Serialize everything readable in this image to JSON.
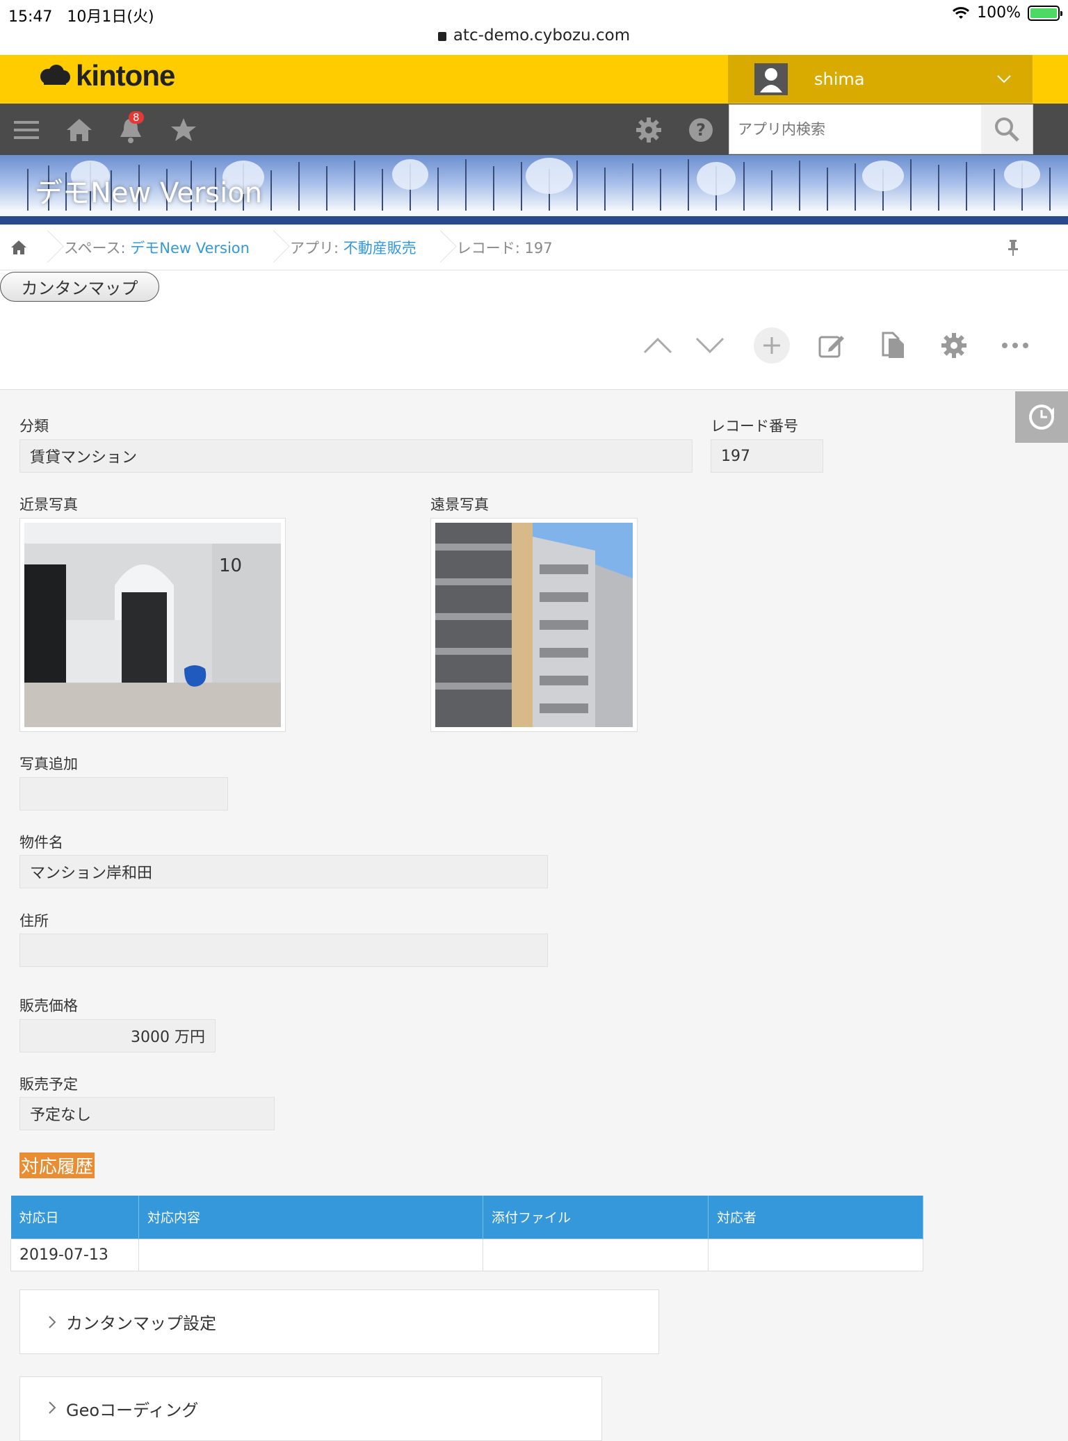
{
  "status_bar": {
    "time": "15:47",
    "date": "10月1日(火)",
    "battery": "100%"
  },
  "browser": {
    "url": "atc-demo.cybozu.com"
  },
  "header": {
    "logo": "kintone",
    "user": "shima",
    "notification_count": "8",
    "search_placeholder": "アプリ内検索"
  },
  "banner": {
    "title": "デモNew Version"
  },
  "breadcrumb": {
    "space_label": "スペース:",
    "space_name": "デモNew Version",
    "app_label": "アプリ:",
    "app_name": "不動産販売",
    "record": "レコード: 197"
  },
  "plugin_button": "カンタンマップ",
  "form": {
    "category_label": "分類",
    "category_value": "賃貸マンション",
    "record_no_label": "レコード番号",
    "record_no_value": "197",
    "near_photo_label": "近景写真",
    "far_photo_label": "遠景写真",
    "add_photo_label": "写真追加",
    "add_photo_value": "",
    "property_label": "物件名",
    "property_value": "マンション岸和田",
    "address_label": "住所",
    "address_value": "",
    "price_label": "販売価格",
    "price_value": "3000 万円",
    "schedule_label": "販売予定",
    "schedule_value": "予定なし"
  },
  "history": {
    "title": "対応履歴",
    "columns": [
      "対応日",
      "対応内容",
      "添付ファイル",
      "対応者"
    ],
    "rows": [
      [
        "2019-07-13",
        "",
        "",
        ""
      ]
    ]
  },
  "groups": [
    "カンタンマップ設定",
    "Geoコーディング"
  ],
  "colors": {
    "brand_yellow": "#ffcc00",
    "toolbar_dark": "#4b4b4b",
    "table_header": "#3498db",
    "history_tag": "#e98d32"
  }
}
